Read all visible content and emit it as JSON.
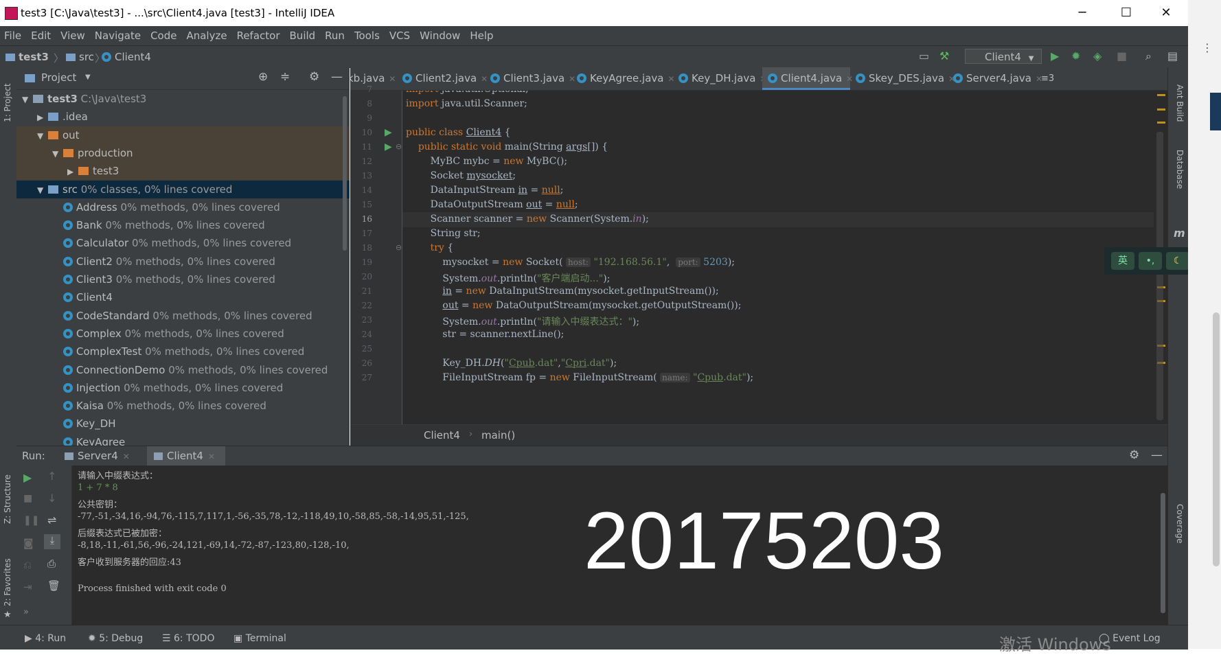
{
  "window": {
    "title": "test3 [C:\\Java\\test3] - ...\\src\\Client4.java [test3] - IntelliJ IDEA",
    "minimize": "─",
    "maximize": "☐",
    "close": "✕"
  },
  "menu": [
    "File",
    "Edit",
    "View",
    "Navigate",
    "Code",
    "Analyze",
    "Refactor",
    "Build",
    "Run",
    "Tools",
    "VCS",
    "Window",
    "Help"
  ],
  "breadcrumb": {
    "project": "test3",
    "folder": "src",
    "file": "Client4"
  },
  "toolbar": {
    "run_config": "Client4"
  },
  "left_strip": {
    "project_label": "1: Project",
    "structure_label": "Z: Structure",
    "favorites_label": "2: Favorites"
  },
  "right_strip": {
    "ant_label": "Ant Build",
    "database_label": "Database",
    "maven_label": "m",
    "coverage_label": "Coverage"
  },
  "project_panel": {
    "title": "Project",
    "tree": [
      {
        "depth": 0,
        "arrow": "▼",
        "icon": "gfolder",
        "name": "test3",
        "extra": "C:\\Java\\test3",
        "bold": true
      },
      {
        "depth": 1,
        "arrow": "▶",
        "icon": "bfolder",
        "name": ".idea",
        "extra": ""
      },
      {
        "depth": 1,
        "arrow": "▼",
        "icon": "ofolder",
        "name": "out",
        "extra": ""
      },
      {
        "depth": 2,
        "arrow": "▼",
        "icon": "ofolder",
        "name": "production",
        "extra": ""
      },
      {
        "depth": 3,
        "arrow": "▶",
        "icon": "ofolder",
        "name": "test3",
        "extra": ""
      },
      {
        "depth": 1,
        "arrow": "▼",
        "icon": "bfolder",
        "name": "src",
        "extra": "0% classes, 0% lines covered",
        "selected": true
      },
      {
        "depth": 2,
        "arrow": "",
        "icon": "class",
        "name": "Address",
        "extra": "0% methods, 0% lines covered"
      },
      {
        "depth": 2,
        "arrow": "",
        "icon": "class",
        "name": "Bank",
        "extra": "0% methods, 0% lines covered"
      },
      {
        "depth": 2,
        "arrow": "",
        "icon": "class",
        "name": "Calculator",
        "extra": "0% methods, 0% lines covered"
      },
      {
        "depth": 2,
        "arrow": "",
        "icon": "class",
        "name": "Client2",
        "extra": "0% methods, 0% lines covered"
      },
      {
        "depth": 2,
        "arrow": "",
        "icon": "class",
        "name": "Client3",
        "extra": "0% methods, 0% lines covered"
      },
      {
        "depth": 2,
        "arrow": "",
        "icon": "class",
        "name": "Client4",
        "extra": ""
      },
      {
        "depth": 2,
        "arrow": "",
        "icon": "class",
        "name": "CodeStandard",
        "extra": "0% methods, 0% lines covered"
      },
      {
        "depth": 2,
        "arrow": "",
        "icon": "class",
        "name": "Complex",
        "extra": "0% methods, 0% lines covered"
      },
      {
        "depth": 2,
        "arrow": "",
        "icon": "class",
        "name": "ComplexTest",
        "extra": "0% methods, 0% lines covered"
      },
      {
        "depth": 2,
        "arrow": "",
        "icon": "class",
        "name": "ConnectionDemo",
        "extra": "0% methods, 0% lines covered"
      },
      {
        "depth": 2,
        "arrow": "",
        "icon": "class",
        "name": "Injection",
        "extra": "0% methods, 0% lines covered"
      },
      {
        "depth": 2,
        "arrow": "",
        "icon": "class",
        "name": "Kaisa",
        "extra": "0% methods, 0% lines covered"
      },
      {
        "depth": 2,
        "arrow": "",
        "icon": "class",
        "name": "Key_DH",
        "extra": ""
      },
      {
        "depth": 2,
        "arrow": "",
        "icon": "class",
        "name": "KeyAgree",
        "extra": ""
      }
    ]
  },
  "editor": {
    "tabs": [
      "kb.java",
      "Client2.java",
      "Client3.java",
      "KeyAgree.java",
      "Key_DH.java",
      "Client4.java",
      "Skey_DES.java",
      "Server4.java"
    ],
    "active_tab": "Client4.java",
    "tab_overflow": "≡3",
    "code_breadcrumb": [
      "Client4",
      "main()"
    ],
    "line_numbers": [
      "7",
      "8",
      "9",
      "10",
      "11",
      "12",
      "13",
      "14",
      "15",
      "16",
      "17",
      "18",
      "19",
      "20",
      "21",
      "22",
      "23",
      "24",
      "25",
      "26",
      "27"
    ],
    "lines": [
      {
        "html": "<span class=\"kw\">import</span> java.util.Optional;"
      },
      {
        "html": "<span class=\"kw\">import</span> java.util.Scanner;"
      },
      {
        "html": ""
      },
      {
        "html": "<span class=\"kw\">public class</span> <u>Client4</u> {"
      },
      {
        "html": "    <span class=\"kw\">public static void</span> main(String <u>args</u>[]) {"
      },
      {
        "html": "        MyBC mybc = <span class=\"kw\">new</span> MyBC();"
      },
      {
        "html": "        Socket <u>mysocket</u>;"
      },
      {
        "html": "        DataInputStream <u>in</u> = <u class=\"kw\">null</u>;"
      },
      {
        "html": "        DataOutputStream <u>out</u> = <u class=\"kw\">null</u>;"
      },
      {
        "html": "        Scanner scanner = <span class=\"kw\">new</span> Scanner(System.<span class=\"it\">in</span>);"
      },
      {
        "html": "        String str;"
      },
      {
        "html": "        <span class=\"kw\">try</span> {"
      },
      {
        "html": "            mysocket = <span class=\"kw\">new</span> Socket( <span class=\"hint\">host:</span> <span class=\"st\">\"192.168.56.1\"</span>,  <span class=\"hint\">port:</span> <span class=\"num\">5203</span>);"
      },
      {
        "html": "            System.<span class=\"it\">out</span>.println(<span class=\"st\">\"客户端启动...\"</span>);"
      },
      {
        "html": "            <u>in</u> = <span class=\"kw\">new</span> DataInputStream(mysocket.getInputStream());"
      },
      {
        "html": "            <u>out</u> = <span class=\"kw\">new</span> DataOutputStream(mysocket.getOutputStream());"
      },
      {
        "html": "            System.<span class=\"it\">out</span>.println(<span class=\"st\">\"请输入中缀表达式：\"</span>);"
      },
      {
        "html": "            str = scanner.nextLine();"
      },
      {
        "html": ""
      },
      {
        "html": "            Key_DH.<i>DH</i>(<span class=\"st\">\"<u>Cpub</u>.dat\"</span>,<span class=\"st\">\"<u>Cpri</u>.dat\"</span>);"
      },
      {
        "html": "            FileInputStream fp = <span class=\"kw\">new</span> FileInputStream( <span class=\"hint\">name:</span> <span class=\"st\">\"<u>Cpub</u>.dat\"</span>);"
      }
    ]
  },
  "run_panel": {
    "label": "Run:",
    "tabs": [
      "Server4",
      "Client4"
    ],
    "console": [
      {
        "text": "请输入中缀表达式：",
        "green": false
      },
      {
        "text": "1 + 7 * 8",
        "green": true
      },
      {
        "text": "公共密钥：",
        "green": false
      },
      {
        "text": "-77,-51,-34,16,-94,76,-115,7,117,1,-56,-35,78,-12,-118,49,10,-58,85,-58,-14,95,51,-125,",
        "green": false
      },
      {
        "text": "后缀表达式已被加密：",
        "green": false
      },
      {
        "text": "-8,18,-11,-61,56,-96,-24,121,-69,14,-72,-87,-123,80,-128,-10,",
        "green": false
      },
      {
        "text": "客户收到服务器的回应:43",
        "green": false
      },
      {
        "text": "",
        "green": false
      },
      {
        "text": "Process finished with exit code 0",
        "green": false
      }
    ],
    "watermark": "20175203"
  },
  "status_bar": {
    "run": "4: Run",
    "debug": "5: Debug",
    "todo": "6: TODO",
    "terminal": "Terminal",
    "event_log": "Event Log",
    "activate_windows": "激活 Windows"
  }
}
